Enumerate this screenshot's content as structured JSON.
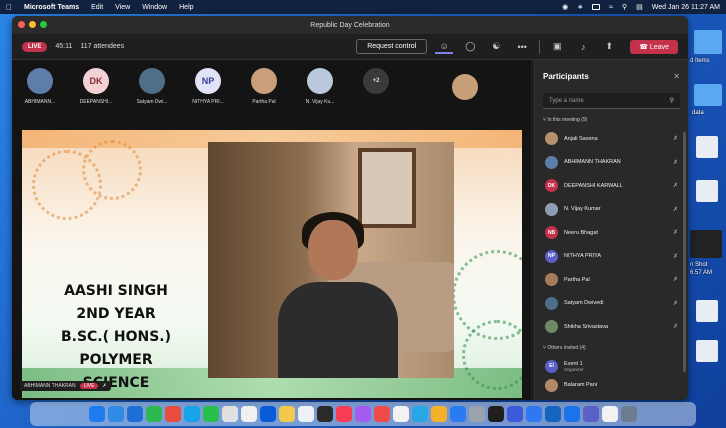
{
  "menubar": {
    "app_name": "Microsoft Teams",
    "items": [
      "Edit",
      "View",
      "Window",
      "Help"
    ],
    "datetime": "Wed Jan 26  11:27 AM"
  },
  "desktop": {
    "labels": [
      "d Items",
      "data",
      "n Shot",
      "6.57 AM"
    ]
  },
  "window": {
    "title": "Republic Day Celebration"
  },
  "toolbar": {
    "live_badge": "LIVE",
    "duration": "45:11",
    "attendees": "117 attendees",
    "request_control": "Request control",
    "more": "•••",
    "leave": "Leave"
  },
  "attendee_strip": [
    {
      "name": "ABHIMANN...",
      "initials": "",
      "color": "#5d7ea8"
    },
    {
      "name": "DEEPANSHI...",
      "initials": "DK",
      "color": "#f3d1d5"
    },
    {
      "name": "Satyam Dwi...",
      "initials": "",
      "color": "#4e6e8a"
    },
    {
      "name": "NITHYA PRI...",
      "initials": "NP",
      "color": "#dfe3f5"
    },
    {
      "name": "Partha Pal",
      "initials": "",
      "color": "#c9a07b"
    },
    {
      "name": "N. Vijay Ku...",
      "initials": "",
      "color": "#b9c8dd"
    },
    {
      "name": "",
      "initials": "+2",
      "color": "#3a3a3a"
    }
  ],
  "slide": {
    "lines": [
      "AASHI SINGH",
      "2ND YEAR",
      "B.SC.( HONS.) POLYMER",
      "SCIENCE"
    ]
  },
  "presenter_tag": {
    "name": "ABHIMANN THAKRAN",
    "live": "LIVE"
  },
  "participants": {
    "title": "Participants",
    "search_placeholder": "Type a name",
    "in_meeting_label": "In this meeting (9)",
    "in_meeting": [
      {
        "name": "Anjali Saxena",
        "initials": "",
        "color": "#b5916d"
      },
      {
        "name": "ABHIMANN THAKRAN",
        "initials": "",
        "color": "#5d7ea8"
      },
      {
        "name": "DEEPANSHI KARWALL",
        "initials": "DK",
        "color": "#c4314b"
      },
      {
        "name": "N. Vijay Kumar",
        "initials": "",
        "color": "#8e9db5"
      },
      {
        "name": "Neeru Bhagat",
        "initials": "NB",
        "color": "#c4314b"
      },
      {
        "name": "NITHYA PRIYA",
        "initials": "NP",
        "color": "#5b5fc7"
      },
      {
        "name": "Partha Pal",
        "initials": "",
        "color": "#a67b5b"
      },
      {
        "name": "Satyam Dwivedi",
        "initials": "",
        "color": "#4e6e8a"
      },
      {
        "name": "Shikha Srivastava",
        "initials": "",
        "color": "#6d8a62"
      }
    ],
    "others_label": "Others invited (4)",
    "others": [
      {
        "name": "Event 1",
        "role": "Organizer",
        "initials": "EI",
        "color": "#5b5fc7"
      },
      {
        "name": "Balaram Pani",
        "role": "",
        "initials": "",
        "color": "#b08a64"
      }
    ]
  },
  "dock_colors": [
    "#1d7cf2",
    "#2f8be6",
    "#1f6fd8",
    "#2eb84f",
    "#e84c3d",
    "#16a3e8",
    "#27c04a",
    "#e0e0e0",
    "#f0f0f0",
    "#0a5bd8",
    "#f2c94c",
    "#eef2f7",
    "#2a2a2a",
    "#fa3c55",
    "#a45cf0",
    "#ef4b4b",
    "#f2f2f2",
    "#27a7e5",
    "#f3b229",
    "#2b7bf0",
    "#9aa3ad",
    "#1f1f1f",
    "#3b5bdb",
    "#2e78f0",
    "#1565c0",
    "#1a73e8",
    "#5b5fc7",
    "#f2f2f2",
    "#6e7c8f"
  ]
}
